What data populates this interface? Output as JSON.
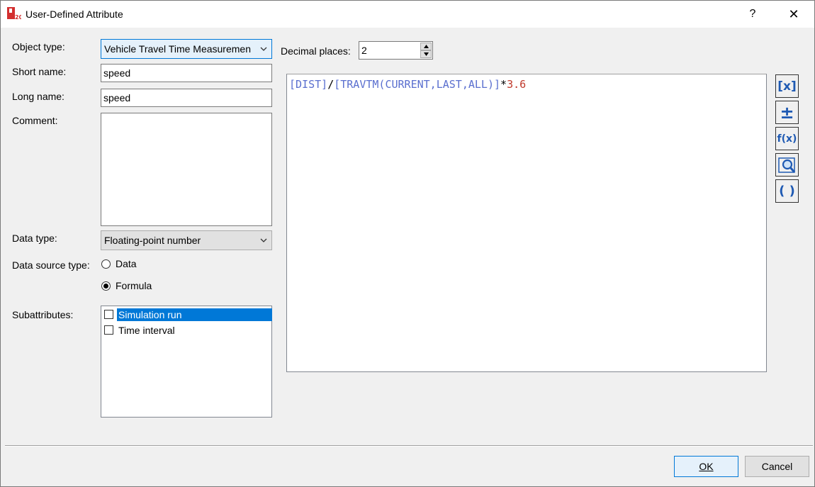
{
  "window": {
    "title": "User-Defined Attribute",
    "help_glyph": "?",
    "close_glyph": "✕",
    "app_icon": "visum-app-icon"
  },
  "form": {
    "object_type_label": "Object type:",
    "object_type_value": "Vehicle Travel Time Measuremen",
    "short_name_label": "Short name:",
    "short_name_value": "speed",
    "long_name_label": "Long name:",
    "long_name_value": "speed",
    "comment_label": "Comment:",
    "comment_value": "",
    "data_type_label": "Data type:",
    "data_type_value": "Floating-point number",
    "data_source_label": "Data source type:",
    "data_source_options": [
      {
        "label": "Data",
        "checked": false
      },
      {
        "label": "Formula",
        "checked": true
      }
    ],
    "subattributes_label": "Subattributes:",
    "subattributes": [
      {
        "label": "Simulation run",
        "checked": false,
        "selected": true
      },
      {
        "label": "Time interval",
        "checked": false,
        "selected": false
      }
    ],
    "decimal_places_label": "Decimal places:",
    "decimal_places_value": "2"
  },
  "formula": {
    "tokens": [
      {
        "text": "[DIST]",
        "kind": "attr"
      },
      {
        "text": "/",
        "kind": "op"
      },
      {
        "text": "[TRAVTM(CURRENT,LAST,ALL)]",
        "kind": "attr"
      },
      {
        "text": "*",
        "kind": "op"
      },
      {
        "text": "3.6",
        "kind": "num"
      }
    ]
  },
  "side_buttons": [
    {
      "name": "insert-attribute-button",
      "glyph": "[x]",
      "icon": "attribute-icon"
    },
    {
      "name": "insert-operator-button",
      "glyph": "±",
      "icon": "plus-minus-icon"
    },
    {
      "name": "insert-function-button",
      "glyph": "f(x)",
      "icon": "function-icon"
    },
    {
      "name": "check-formula-button",
      "glyph": "🔍",
      "icon": "magnifier-icon"
    },
    {
      "name": "insert-brackets-button",
      "glyph": "( )",
      "icon": "brackets-icon"
    }
  ],
  "buttons": {
    "ok_label": "OK",
    "cancel_label": "Cancel"
  },
  "colors": {
    "attribute_token": "#5a6fcf",
    "number_token": "#c0392b",
    "selection": "#0078d7"
  }
}
